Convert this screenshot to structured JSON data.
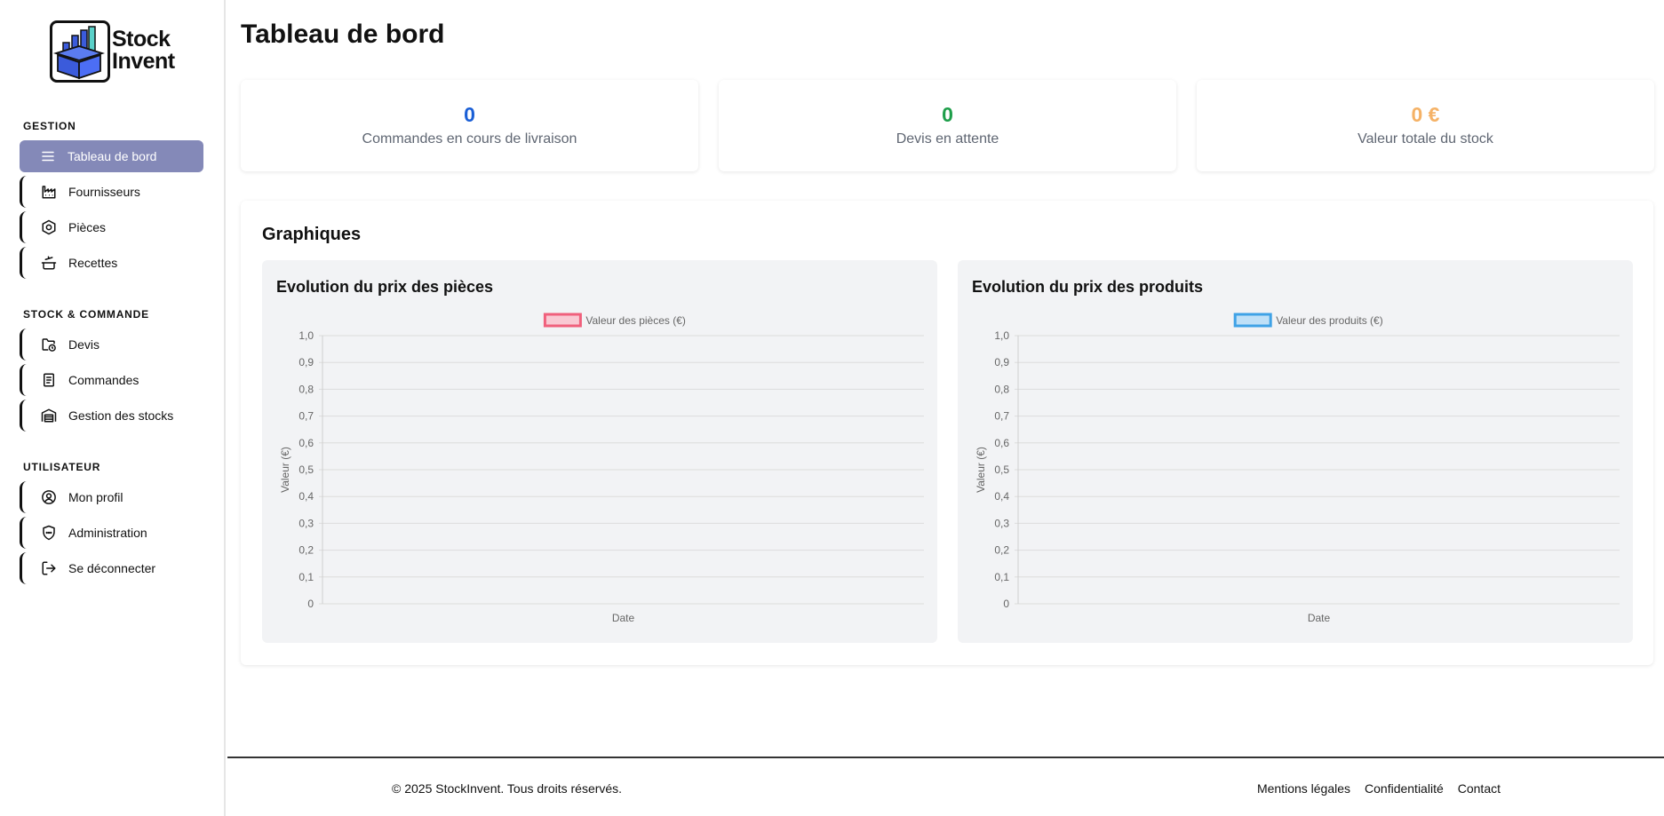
{
  "brand": {
    "name_line1": "Stock",
    "name_line2": "Invent",
    "logo_icon": "box-chart-logo"
  },
  "sidebar": {
    "sections": [
      {
        "title": "GESTION",
        "items": [
          {
            "label": "Tableau de bord",
            "icon": "menu-icon",
            "active": true
          },
          {
            "label": "Fournisseurs",
            "icon": "factory-icon"
          },
          {
            "label": "Pièces",
            "icon": "hex-nut-icon"
          },
          {
            "label": "Recettes",
            "icon": "cooking-pot-icon"
          }
        ]
      },
      {
        "title": "STOCK & COMMANDE",
        "items": [
          {
            "label": "Devis",
            "icon": "folder-clock-icon"
          },
          {
            "label": "Commandes",
            "icon": "document-icon"
          },
          {
            "label": "Gestion des stocks",
            "icon": "warehouse-icon"
          }
        ]
      },
      {
        "title": "UTILISATEUR",
        "items": [
          {
            "label": "Mon profil",
            "icon": "user-circle-icon"
          },
          {
            "label": "Administration",
            "icon": "shield-icon"
          },
          {
            "label": "Se déconnecter",
            "icon": "logout-icon"
          }
        ]
      }
    ]
  },
  "header": {
    "title": "Tableau de bord"
  },
  "stats": [
    {
      "value": "0",
      "label": "Commandes en cours de livraison",
      "color": "#1a5fd6"
    },
    {
      "value": "0",
      "label": "Devis en attente",
      "color": "#1e9e4a"
    },
    {
      "value": "0 €",
      "label": "Valeur totale du stock",
      "color": "#f5b266"
    }
  ],
  "graphs": {
    "title": "Graphiques"
  },
  "chart_data": [
    {
      "type": "line",
      "title": "Evolution du prix des pièces",
      "series": [
        {
          "name": "Valeur des pièces (€)",
          "values": [],
          "color": "#f0607c",
          "fill": "#f9c9d3"
        }
      ],
      "x": [],
      "xlabel": "Date",
      "ylabel": "Valeur (€)",
      "ylim": [
        0,
        1
      ],
      "yticks": [
        "0",
        "0,1",
        "0,2",
        "0,3",
        "0,4",
        "0,5",
        "0,6",
        "0,7",
        "0,8",
        "0,9",
        "1,0"
      ],
      "legend": "top-center",
      "grid": true
    },
    {
      "type": "line",
      "title": "Evolution du prix des produits",
      "series": [
        {
          "name": "Valeur des produits (€)",
          "values": [],
          "color": "#3fa2e6",
          "fill": "#bfe0f7"
        }
      ],
      "x": [],
      "xlabel": "Date",
      "ylabel": "Valeur (€)",
      "ylim": [
        0,
        1
      ],
      "yticks": [
        "0",
        "0,1",
        "0,2",
        "0,3",
        "0,4",
        "0,5",
        "0,6",
        "0,7",
        "0,8",
        "0,9",
        "1,0"
      ],
      "legend": "top-center",
      "grid": true
    }
  ],
  "footer": {
    "copyright": "© 2025 StockInvent. Tous droits réservés.",
    "links": [
      "Mentions légales",
      "Confidentialité",
      "Contact"
    ]
  }
}
